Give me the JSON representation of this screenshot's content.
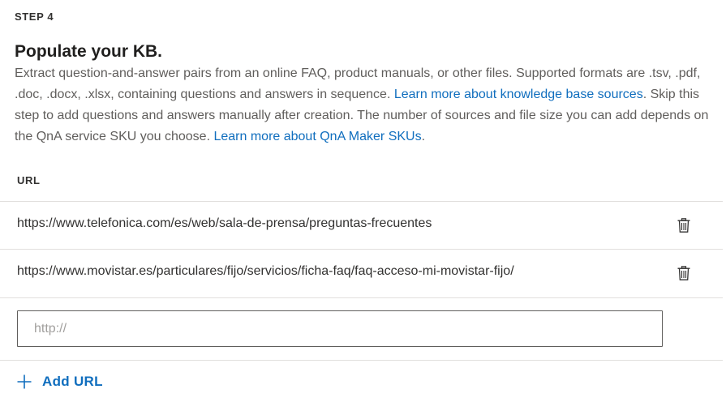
{
  "step": {
    "label": "STEP 4"
  },
  "section": {
    "title": "Populate your KB.",
    "description_part1": "Extract question-and-answer pairs from an online FAQ, product manuals, or other files. Supported formats are .tsv, .pdf, .doc, .docx, .xlsx, containing questions and answers in sequence. ",
    "link1": "Learn more about knowledge base sources",
    "description_part2": ". Skip this step to add questions and answers manually after creation. The number of sources and file size you can add depends on the QnA service SKU you choose. ",
    "link2": "Learn more about QnA Maker SKUs",
    "description_part3": "."
  },
  "url_table": {
    "header": "URL",
    "rows": [
      {
        "url": "https://www.telefonica.com/es/web/sala-de-prensa/preguntas-frecuentes",
        "delete_icon": "trash-icon"
      },
      {
        "url": "https://www.movistar.es/particulares/fijo/servicios/ficha-faq/faq-acceso-mi-movistar-fijo/",
        "delete_icon": "trash-icon"
      }
    ],
    "input": {
      "value": "",
      "placeholder": "http://"
    },
    "add_button": {
      "label": "Add URL",
      "icon": "plus-icon"
    }
  },
  "colors": {
    "link": "#106ebe",
    "text": "#323130",
    "secondary_text": "#605e5c",
    "divider": "#e1dfdd"
  }
}
